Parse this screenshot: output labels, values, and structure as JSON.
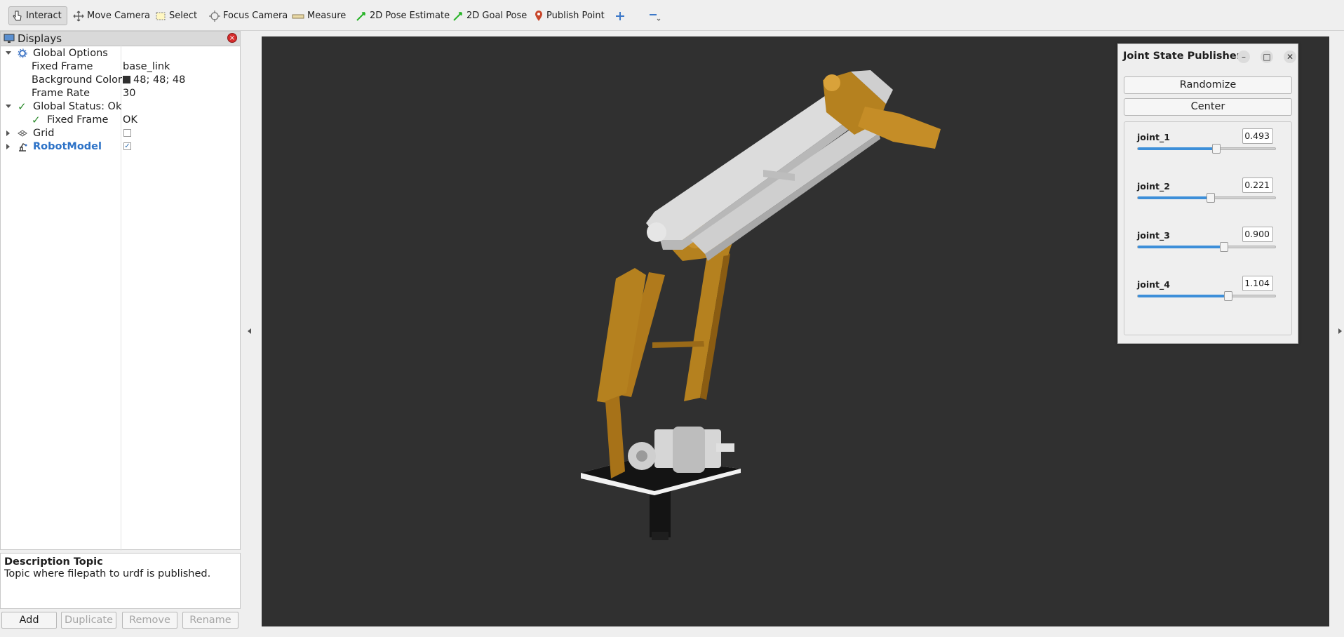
{
  "toolbar": {
    "items": [
      {
        "label": "Interact",
        "icon": "hand-pointer-icon"
      },
      {
        "label": "Move Camera",
        "icon": "move-camera-icon"
      },
      {
        "label": "Select",
        "icon": "select-box-icon"
      },
      {
        "label": "Focus Camera",
        "icon": "focus-camera-icon"
      },
      {
        "label": "Measure",
        "icon": "ruler-icon"
      },
      {
        "label": "2D Pose Estimate",
        "icon": "green-arrow-icon"
      },
      {
        "label": "2D Goal Pose",
        "icon": "green-arrow-icon"
      },
      {
        "label": "Publish Point",
        "icon": "map-pin-icon"
      }
    ]
  },
  "displays": {
    "title": "Displays",
    "tree": {
      "global_options": {
        "label": "Global Options"
      },
      "fixed_frame": {
        "label": "Fixed Frame",
        "value": "base_link"
      },
      "background_color": {
        "label": "Background Color",
        "value": "48; 48; 48",
        "swatch": "#303030"
      },
      "frame_rate": {
        "label": "Frame Rate",
        "value": "30"
      },
      "global_status": {
        "label": "Global Status: Ok"
      },
      "status_fixed_frame": {
        "label": "Fixed Frame",
        "value": "OK"
      },
      "grid": {
        "label": "Grid",
        "checked": false
      },
      "robot_model": {
        "label": "RobotModel",
        "checked": true
      }
    }
  },
  "description": {
    "title": "Description Topic",
    "text": "Topic where filepath to urdf is published."
  },
  "bottom_buttons": {
    "add": "Add",
    "duplicate": "Duplicate",
    "remove": "Remove",
    "rename": "Rename"
  },
  "viewport": {
    "background": "#303030"
  },
  "joint_state_publisher": {
    "title": "Joint State Publisher",
    "randomize": "Randomize",
    "center": "Center",
    "joints": [
      {
        "name": "joint_1",
        "value": "0.493",
        "fraction": 0.57
      },
      {
        "name": "joint_2",
        "value": "0.221",
        "fraction": 0.53
      },
      {
        "name": "joint_3",
        "value": "0.900",
        "fraction": 0.63
      },
      {
        "name": "joint_4",
        "value": "1.104",
        "fraction": 0.66
      }
    ]
  }
}
